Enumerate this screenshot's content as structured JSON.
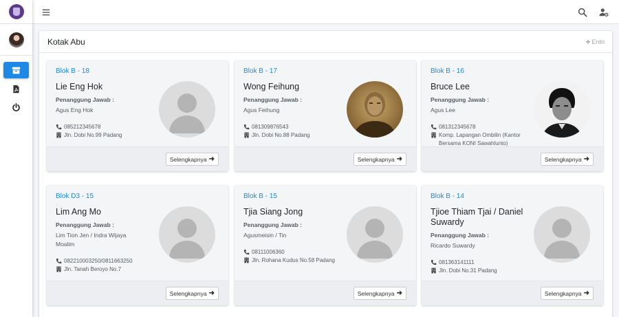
{
  "sidebar": {
    "items": [
      {
        "icon": "archive-icon",
        "active": true
      },
      {
        "icon": "pdf-file-icon",
        "active": false
      },
      {
        "icon": "power-icon",
        "active": false
      }
    ]
  },
  "navbar": {
    "menu_icon": "hamburger-icon",
    "search_icon": "search-icon",
    "user_settings_icon": "user-cog-icon"
  },
  "main": {
    "title": "Kotak Abu",
    "add_label": "Entri",
    "more_label": "Selengkapnya",
    "pj_label": "Penanggung Jawab :",
    "cards": [
      {
        "blok": "Blok B - 18",
        "name": "Lie Eng Hok",
        "pj": "Agus Eng Hok",
        "phone": "085212345678",
        "address": "Jln. Dobi No.99 Padang",
        "photo": "placeholder"
      },
      {
        "blok": "Blok B - 17",
        "name": "Wong Feihung",
        "pj": "Agus Feihung",
        "phone": "081309876543",
        "address": "Jln. Dobi No.88 Padang",
        "photo": "sepia-portrait"
      },
      {
        "blok": "Blok B - 16",
        "name": "Bruce Lee",
        "pj": "Agus Lee",
        "phone": "081312345678",
        "address": "Komp. Lapangan Ombilin (Kantor Bersama KONI Sawahlunto)",
        "photo": "bw-portrait"
      },
      {
        "blok": "Blok D3 - 15",
        "name": "Lim Ang Mo",
        "pj": "Lim Tion Jen / Indra Wijaya Moalim",
        "phone": "082210003250/0811663250",
        "address": "Jln. Tanah Beroyo No.7",
        "photo": "placeholder"
      },
      {
        "blok": "Blok B - 15",
        "name": "Tjia Siang Jong",
        "pj": "Agusmeisin / Tin",
        "phone": "08111006360",
        "address": "Jln. Rohana Kudus No.58 Padang",
        "photo": "placeholder"
      },
      {
        "blok": "Blok B - 14",
        "name": "Tjioe Thiam Tjai / Daniel Suwardy",
        "pj": "Ricardo Suwardy",
        "phone": "081363141111",
        "address": "Jln. Dobi No.31 Padang",
        "photo": "placeholder"
      }
    ]
  }
}
